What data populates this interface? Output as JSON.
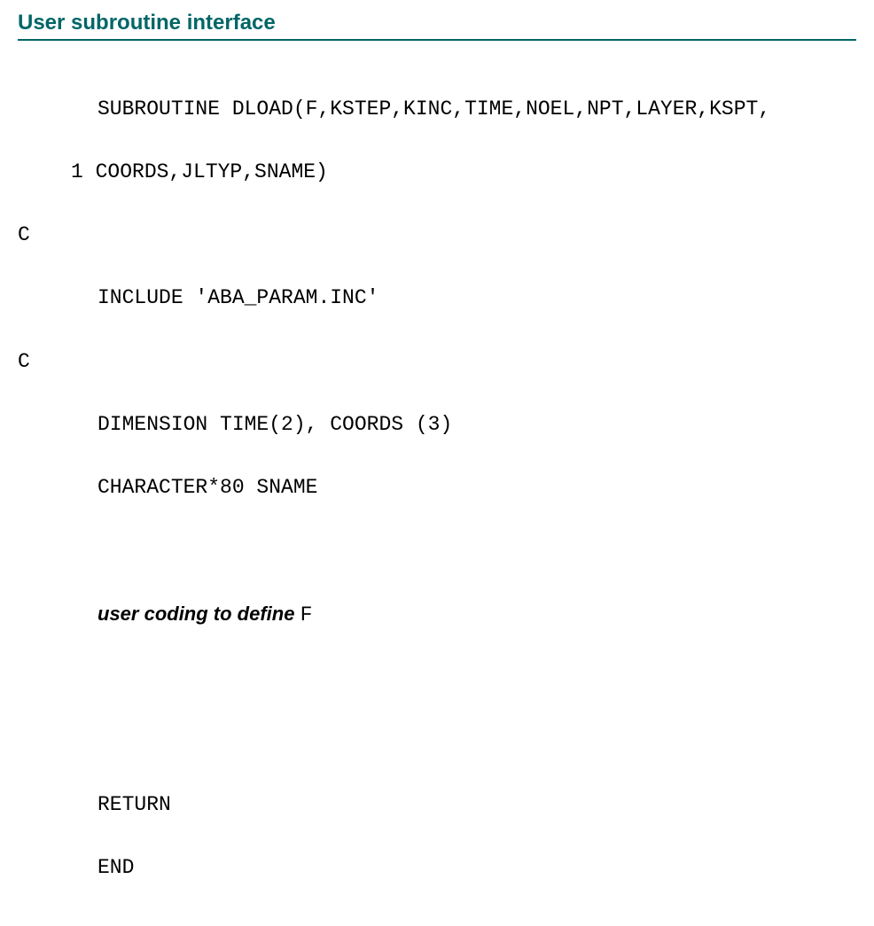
{
  "title": "User subroutine interface",
  "code": {
    "l1": "SUBROUTINE DLOAD(F,KSTEP,KINC,TIME,NOEL,NPT,LAYER,KSPT,",
    "l2": "1 COORDS,JLTYP,SNAME)",
    "l3": "C",
    "l4": "INCLUDE 'ABA_PARAM.INC'",
    "l5": "C",
    "l6": "DIMENSION TIME(2), COORDS (3)",
    "l7": "CHARACTER*80 SNAME",
    "l8a": "user coding to define ",
    "l8b": "F",
    "l9": "RETURN",
    "l10": "END"
  }
}
